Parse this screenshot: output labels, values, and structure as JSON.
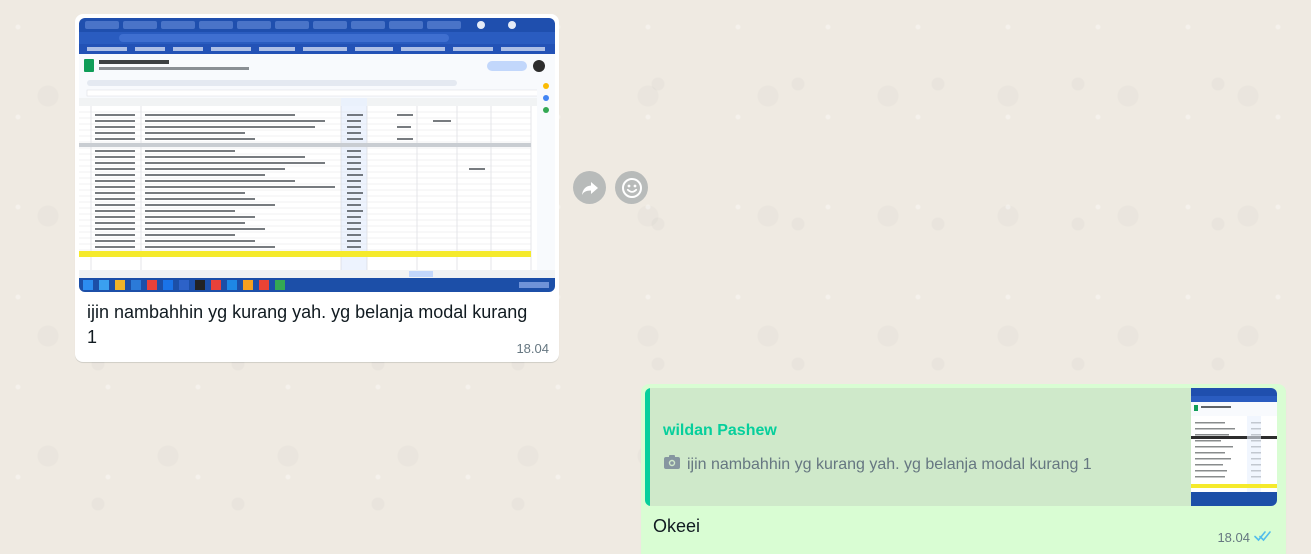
{
  "incoming": {
    "caption": "ijin nambahhin yg kurang yah. yg belanja modal kurang 1",
    "time": "18.04",
    "image_icon": "spreadsheet-screenshot"
  },
  "actions": {
    "forward_icon": "forward-icon",
    "emoji_icon": "emoji-reaction-icon"
  },
  "outgoing": {
    "quoted_author": "wildan Pashew",
    "quoted_text": "ijin nambahhin yg kurang yah. yg belanja modal kurang 1",
    "quoted_icon": "camera-icon",
    "text": "Okeei",
    "time": "18.04",
    "status_icon": "double-check-icon"
  },
  "colors": {
    "chat_bg": "#efeae2",
    "incoming_bubble": "#ffffff",
    "outgoing_bubble": "#d9fdd3",
    "quote_accent": "#06cf9c",
    "read_ticks": "#53bdeb"
  }
}
